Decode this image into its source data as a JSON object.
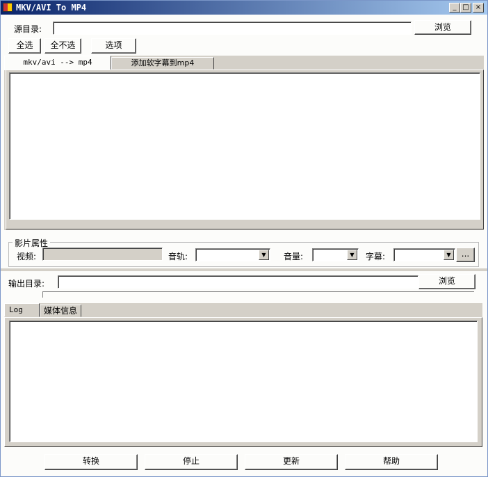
{
  "window": {
    "title": "MKV/AVI To MP4",
    "minimize": "_",
    "maximize": "□",
    "close": "×"
  },
  "source": {
    "label": "源目录:",
    "value": "",
    "browse": "浏览"
  },
  "toolbar": {
    "select_all": "全选",
    "select_none": "全不选",
    "options": "选项"
  },
  "top_tabs": [
    {
      "label": "mkv/avi --> mp4"
    },
    {
      "label": "添加软字幕到mp4"
    }
  ],
  "properties": {
    "group_label": "影片属性",
    "video_label": "视频:",
    "audio_label": "音轨:",
    "volume_label": "音量:",
    "subtitle_label": "字幕:",
    "more": "...",
    "dropdown_glyph": "▼"
  },
  "output": {
    "label": "输出目录:",
    "value": "",
    "browse": "浏览",
    "progress": 0
  },
  "bottom_tabs": [
    {
      "label": "Log"
    },
    {
      "label": "媒体信息"
    }
  ],
  "actions": {
    "convert": "转换",
    "stop": "停止",
    "update": "更新",
    "help": "帮助"
  }
}
